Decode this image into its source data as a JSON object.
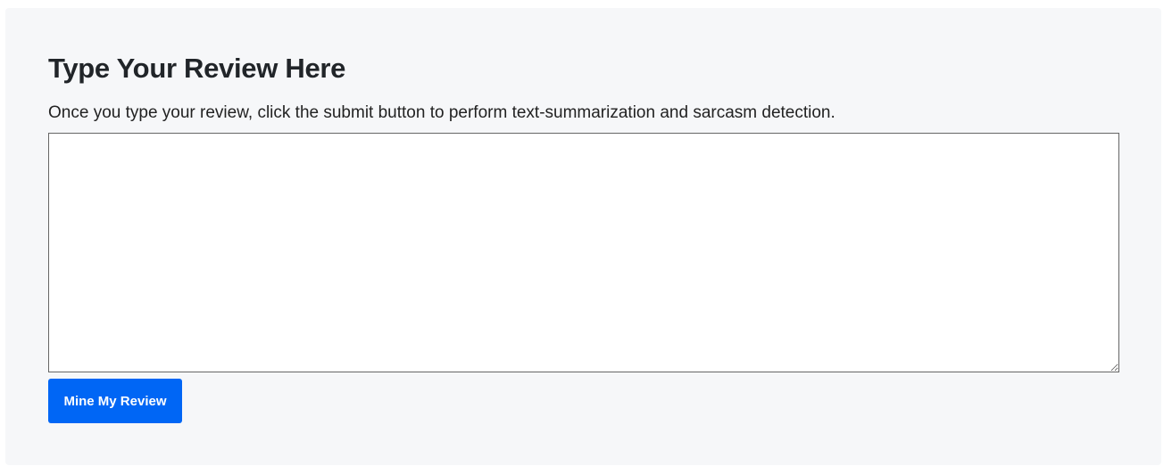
{
  "form": {
    "title": "Type Your Review Here",
    "description": "Once you type your review, click the submit button to perform text-summarization and sarcasm detection.",
    "review_value": "",
    "submit_label": "Mine My Review",
    "accent_color": "#0066f5"
  }
}
